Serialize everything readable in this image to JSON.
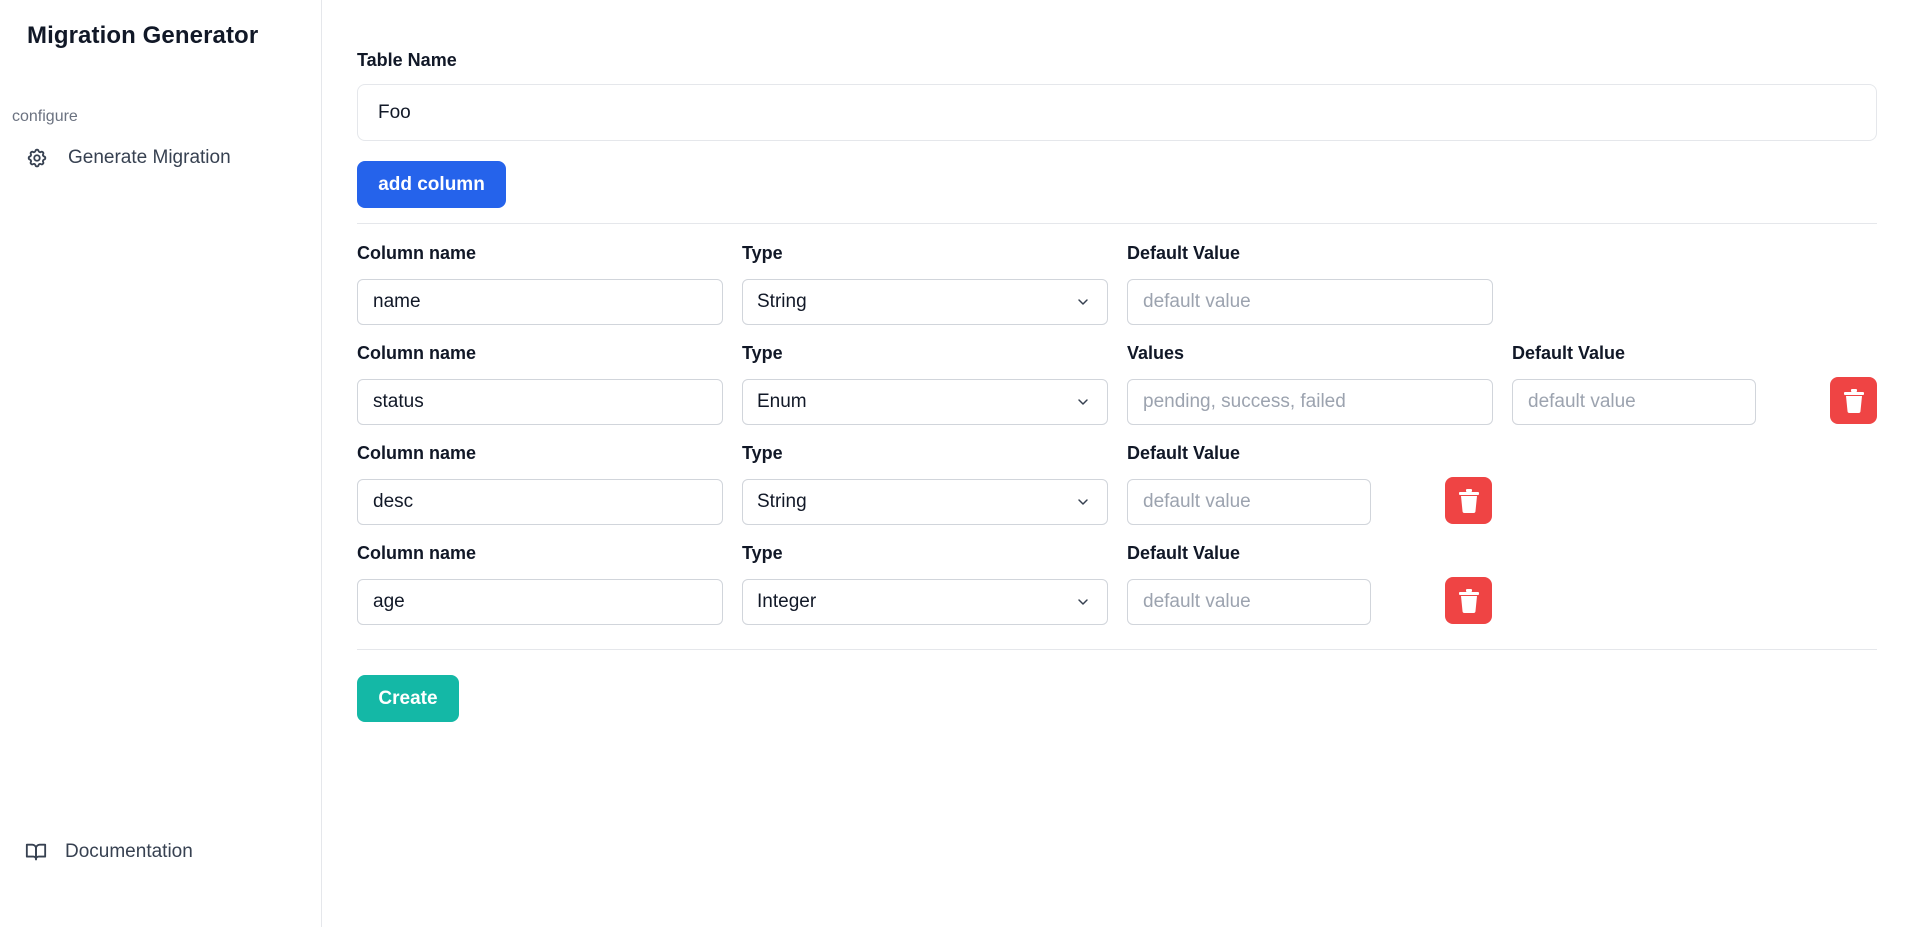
{
  "app": {
    "title": "Migration Generator"
  },
  "sidebar": {
    "section_label": "configure",
    "items": [
      {
        "label": "Generate Migration",
        "icon": "gear-icon"
      }
    ],
    "bottom_item": {
      "label": "Documentation",
      "icon": "book-icon"
    }
  },
  "form": {
    "table_name_label": "Table Name",
    "table_name_value": "Foo",
    "add_column_label": "add column",
    "create_label": "Create",
    "columns": [
      {
        "name_label": "Column name",
        "name_value": "name",
        "type_label": "Type",
        "type_value": "String",
        "default_label": "Default Value",
        "default_placeholder": "default value"
      },
      {
        "name_label": "Column name",
        "name_value": "status",
        "type_label": "Type",
        "type_value": "Enum",
        "values_label": "Values",
        "values_placeholder": "pending, success, failed",
        "default_label": "Default Value",
        "default_placeholder": "default value"
      },
      {
        "name_label": "Column name",
        "name_value": "desc",
        "type_label": "Type",
        "type_value": "String",
        "default_label": "Default Value",
        "default_placeholder": "default value"
      },
      {
        "name_label": "Column name",
        "name_value": "age",
        "type_label": "Type",
        "type_value": "Integer",
        "default_label": "Default Value",
        "default_placeholder": "default value"
      }
    ]
  },
  "colors": {
    "primary": "#2563eb",
    "success": "#14b8a6",
    "danger": "#ef4444",
    "border": "#d1d5db"
  }
}
